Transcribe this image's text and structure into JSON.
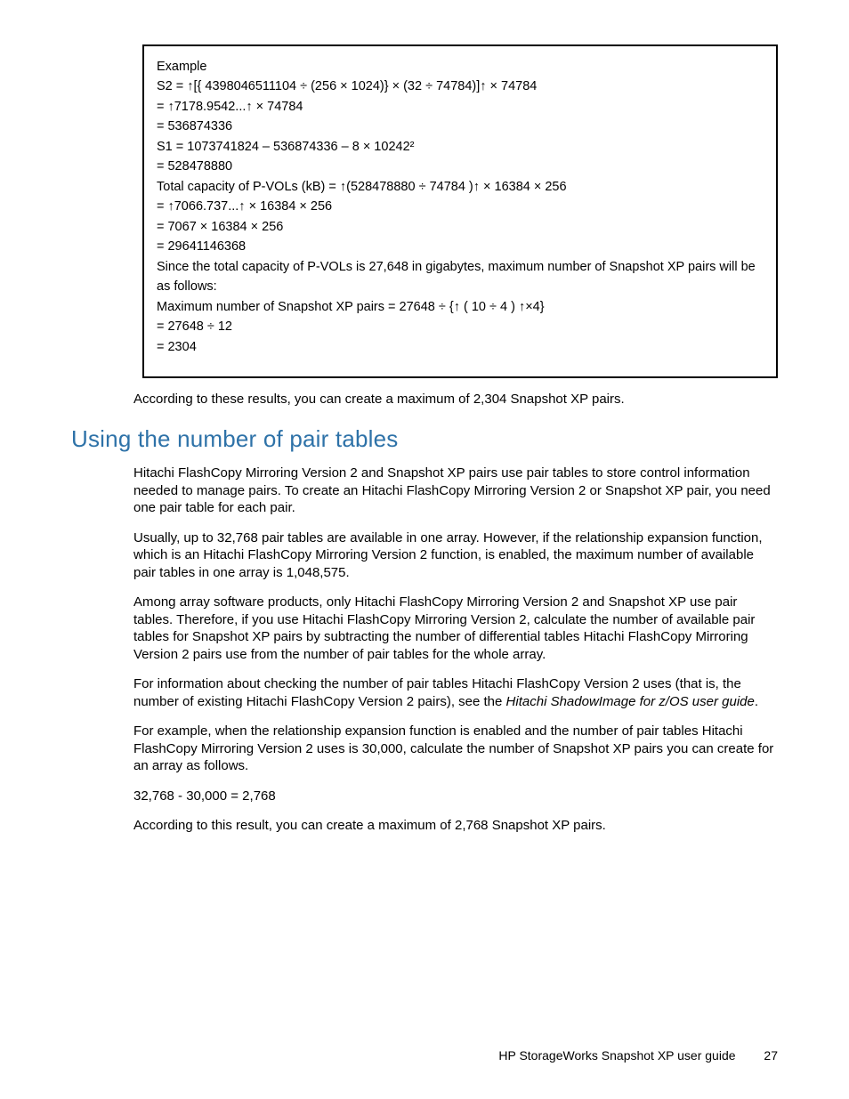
{
  "example": {
    "title": "Example",
    "lines": [
      "S2 = ↑[{ 4398046511104 ÷ (256 × 1024)} × (32 ÷ 74784)]↑ × 74784",
      "= ↑7178.9542...↑ × 74784",
      "= 536874336",
      "S1 = 1073741824 – 536874336 – 8 × 10242²",
      "= 528478880",
      "Total capacity of P-VOLs (kB) = ↑(528478880 ÷ 74784 )↑ × 16384 × 256",
      "= ↑7066.737...↑ × 16384 × 256",
      "= 7067 × 16384 × 256",
      "= 29641146368",
      "Since the total capacity of P-VOLs is 27,648 in gigabytes, maximum number of Snapshot XP pairs will be as follows:",
      "Maximum number of Snapshot XP pairs = 27648 ÷ {↑ ( 10 ÷ 4 ) ↑×4}",
      "= 27648 ÷ 12",
      "= 2304"
    ]
  },
  "after_example": "According to these results, you can create a maximum of 2,304 Snapshot XP pairs.",
  "section_heading": "Using the number of pair tables",
  "paragraphs": {
    "p1": "Hitachi FlashCopy Mirroring Version 2 and Snapshot XP pairs use pair tables to store control information needed to manage pairs. To create an Hitachi FlashCopy Mirroring Version 2 or Snapshot XP pair, you need one pair table for each pair.",
    "p2": "Usually, up to 32,768 pair tables are available in one array. However, if the relationship expansion function, which is an Hitachi FlashCopy Mirroring Version 2 function, is enabled, the maximum number of available pair tables in one array is 1,048,575.",
    "p3": "Among array software products, only Hitachi FlashCopy Mirroring Version 2 and Snapshot XP use pair tables. Therefore, if you use Hitachi FlashCopy Mirroring Version 2, calculate the number of available pair tables for Snapshot XP pairs by subtracting the number of differential tables Hitachi FlashCopy Mirroring Version 2 pairs use from the number of pair tables for the whole array.",
    "p4a": "For information about checking the number of pair tables Hitachi FlashCopy Version 2 uses (that is, the number of existing Hitachi FlashCopy Version 2 pairs), see the ",
    "p4b": "Hitachi ShadowImage for z/OS user guide",
    "p4c": ".",
    "p5": "For example, when the relationship expansion function is enabled and the number of pair tables Hitachi FlashCopy Mirroring Version 2 uses is 30,000, calculate the number of Snapshot XP pairs you can create for an array as follows.",
    "p6": "32,768 - 30,000 = 2,768",
    "p7": "According to this result, you can create a maximum of 2,768 Snapshot XP pairs."
  },
  "footer": {
    "title": "HP StorageWorks Snapshot XP user guide",
    "page": "27"
  }
}
